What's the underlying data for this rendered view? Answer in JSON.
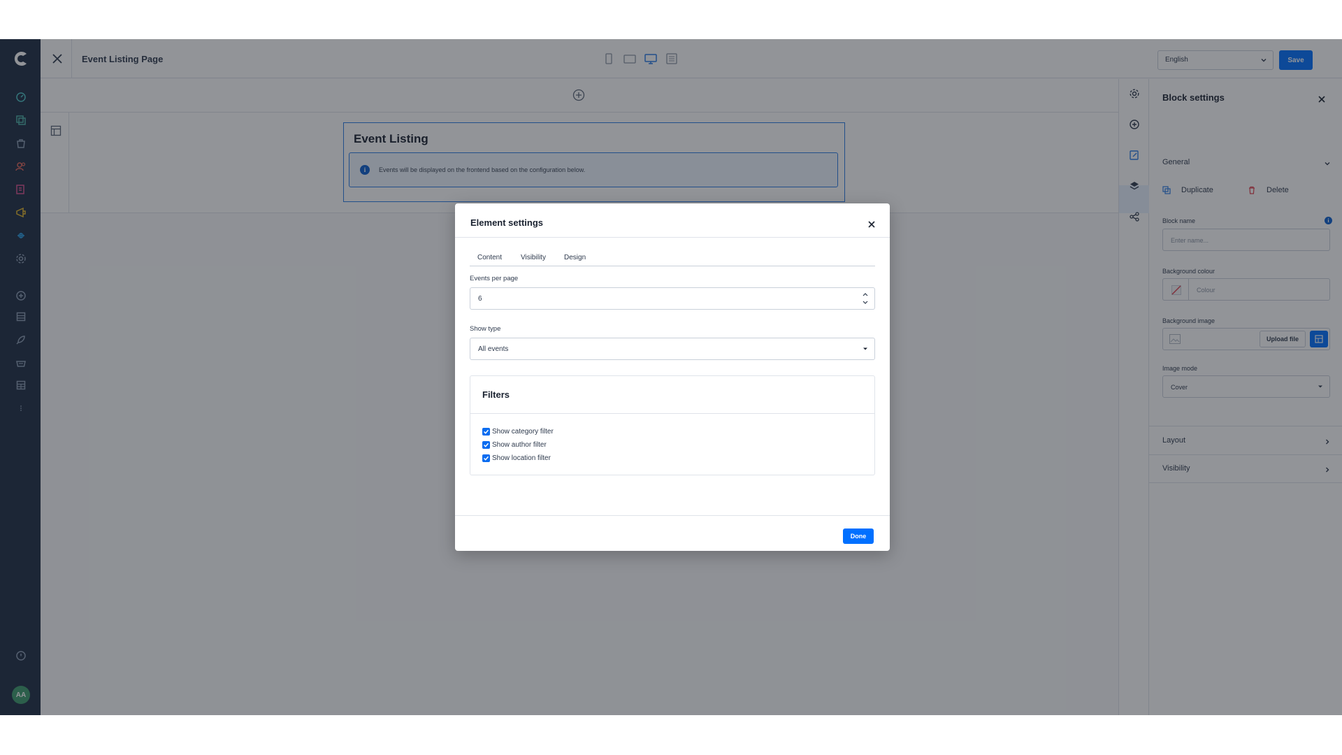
{
  "topbar": {
    "page_title": "Event Listing Page",
    "language": "English",
    "save_label": "Save"
  },
  "canvas": {
    "block_heading": "Event Listing",
    "info_text": "Events will be displayed on the frontend based on the configuration below."
  },
  "block_settings": {
    "title": "Block settings",
    "general_label": "General",
    "duplicate_label": "Duplicate",
    "delete_label": "Delete",
    "block_name_label": "Block name",
    "block_name_placeholder": "Enter name...",
    "bg_colour_label": "Background colour",
    "bg_colour_placeholder": "Colour",
    "bg_image_label": "Background image",
    "upload_label": "Upload file",
    "image_mode_label": "Image mode",
    "image_mode_value": "Cover",
    "layout_label": "Layout",
    "visibility_label": "Visibility"
  },
  "modal": {
    "title": "Element settings",
    "tabs": [
      {
        "label": "Content"
      },
      {
        "label": "Visibility"
      },
      {
        "label": "Design"
      }
    ],
    "events_per_page_label": "Events per page",
    "events_per_page_value": "6",
    "show_type_label": "Show type",
    "show_type_value": "All events",
    "filters_title": "Filters",
    "filters": [
      {
        "label": "Show category filter",
        "checked": true
      },
      {
        "label": "Show author filter",
        "checked": true
      },
      {
        "label": "Show location filter",
        "checked": true
      }
    ],
    "done_label": "Done"
  },
  "user": {
    "initials": "AA"
  },
  "colors": {
    "accent": "#0070ff",
    "rail": "#1e2d44",
    "avatar": "#3c9a6c"
  }
}
